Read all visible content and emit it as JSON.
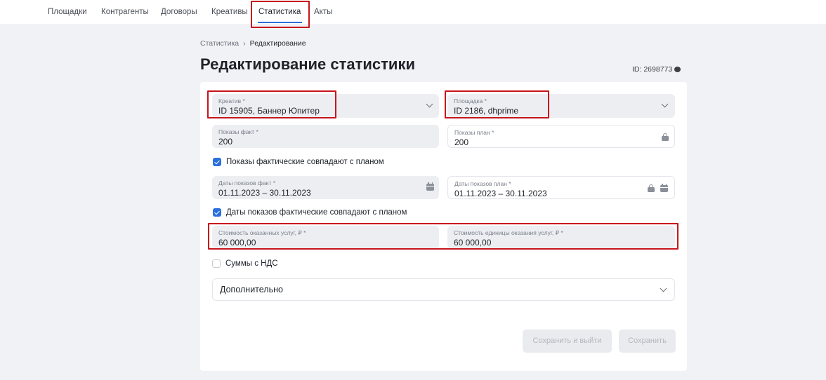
{
  "nav": {
    "items": [
      "Площадки",
      "Контрагенты",
      "Договоры",
      "Креативы",
      "Статистика",
      "Акты"
    ],
    "active": "Статистика"
  },
  "breadcrumb": {
    "parent": "Статистика",
    "separator": "›",
    "current": "Редактирование"
  },
  "page": {
    "title": "Редактирование статистики",
    "id_text": "ID: 2698773"
  },
  "form": {
    "creative": {
      "label": "Креатив *",
      "value": "ID 15905, Баннер Юпитер"
    },
    "platform": {
      "label": "Площадка *",
      "value": "ID 2186, dhprime"
    },
    "impressions_fact": {
      "label": "Показы факт *",
      "value": "200"
    },
    "impressions_plan": {
      "label": "Показы план *",
      "value": "200"
    },
    "impressions_match": {
      "label": "Показы фактические совпадают с планом",
      "checked": true
    },
    "dates_fact": {
      "label": "Даты показов факт *",
      "value": "01.11.2023 – 30.11.2023"
    },
    "dates_plan": {
      "label": "Даты показов план *",
      "value": "01.11.2023 – 30.11.2023"
    },
    "dates_match": {
      "label": "Даты показов фактические совпадают с планом",
      "checked": true
    },
    "services_cost": {
      "label": "Стоимость оказанных услуг, ₽ *",
      "value": "60 000,00"
    },
    "unit_cost": {
      "label": "Стоимость единицы оказания услуг, ₽ *",
      "value": "60 000,00"
    },
    "vat": {
      "label": "Суммы с НДС",
      "checked": false
    },
    "additional": {
      "label": "Дополнительно"
    }
  },
  "buttons": {
    "save_exit": "Сохранить и выйти",
    "save": "Сохранить"
  },
  "colors": {
    "accent": "#2a6fdc",
    "highlight": "#c8141c",
    "background": "#f1f2f5",
    "field": "#eceef2"
  }
}
